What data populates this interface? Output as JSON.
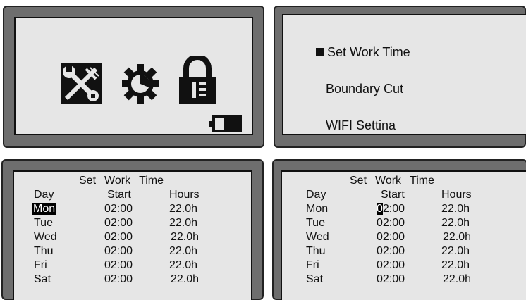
{
  "menu": {
    "items": [
      {
        "label": "Set Work Time",
        "selected": true
      },
      {
        "label": "Boundary Cut",
        "selected": false
      },
      {
        "label": "WIFI Settina",
        "selected": false
      }
    ]
  },
  "icons": {
    "tools": "tools-icon",
    "gear": "gear-icon",
    "lock": "lock-icon",
    "battery": "battery-icon"
  },
  "schedule_left": {
    "title": {
      "w1": "Set",
      "w2": "Work",
      "w3": "Time"
    },
    "headers": {
      "day": "Day",
      "start": "Start",
      "hours": "Hours"
    },
    "rows": [
      {
        "day": "Mon",
        "start": "02:00",
        "hours": "22.0h"
      },
      {
        "day": "Tue",
        "start": "02:00",
        "hours": "22.0h"
      },
      {
        "day": "Wed",
        "start": "02:00",
        "hours": "22.0h"
      },
      {
        "day": "Thu",
        "start": "02:00",
        "hours": "22.0h"
      },
      {
        "day": "Fri",
        "start": "02:00",
        "hours": "22.0h"
      },
      {
        "day": "Sat",
        "start": "02:00",
        "hours": "22.0h"
      }
    ],
    "selected_day": "Mon"
  },
  "schedule_right": {
    "title": {
      "w1": "Set",
      "w2": "Work",
      "w3": "Time"
    },
    "headers": {
      "day": "Day",
      "start": "Start",
      "hours": "Hours"
    },
    "rows": [
      {
        "day": "Mon",
        "start_cursor": "0",
        "start_rest": "2:00",
        "hours": "22.0h"
      },
      {
        "day": "Tue",
        "start": "02:00",
        "hours": "22.0h"
      },
      {
        "day": "Wed",
        "start": "02:00",
        "hours": "22.0h"
      },
      {
        "day": "Thu",
        "start": "02:00",
        "hours": "22.0h"
      },
      {
        "day": "Fri",
        "start": "02:00",
        "hours": "22.0h"
      },
      {
        "day": "Sat",
        "start": "02:00",
        "hours": "22.0h"
      }
    ]
  },
  "colors": {
    "bezel": "#6e6e6e",
    "screen": "#e6e6e6",
    "ink": "#111111"
  }
}
